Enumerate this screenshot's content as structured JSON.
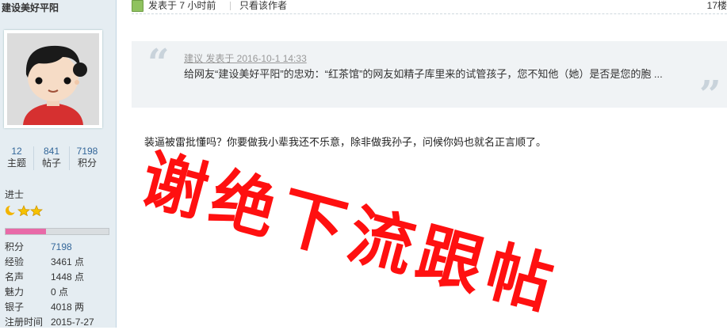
{
  "user": {
    "name": "建设美好平阳",
    "stats": [
      {
        "value": "12",
        "label": "主题"
      },
      {
        "value": "841",
        "label": "帖子"
      },
      {
        "value": "7198",
        "label": "积分"
      }
    ],
    "rank": "进士",
    "star_icons": [
      "moon-icon",
      "star-icon",
      "star-icon"
    ],
    "progress_fraction": 0.39,
    "profile": [
      {
        "key": "积分",
        "value": "7198",
        "link": true
      },
      {
        "key": "经验",
        "value": "3461 点",
        "link": false
      },
      {
        "key": "名声",
        "value": "1448 点",
        "link": false
      },
      {
        "key": "魅力",
        "value": "0 点",
        "link": false
      },
      {
        "key": "银子",
        "value": "4018 两",
        "link": false
      },
      {
        "key": "注册时间",
        "value": "2015-7-27",
        "link": false
      }
    ]
  },
  "post": {
    "posted_label": "发表于 7 小时前",
    "author_only": "只看该作者",
    "floor": "17楼",
    "quote": {
      "header": "建议 发表于 2016-10-1 14:33",
      "text": "给网友“建设美好平阳”的忠劝：“红茶馆”的网友如精子库里来的试管孩子，您不知他（她）是否是您的胞 ..."
    },
    "reply": "装逼被雷批懂吗？你要做我小辈我还不乐意，除非做我孙子，问候你妈也就名正言顺了。",
    "overlay_text": "谢绝下流跟帖"
  },
  "colors": {
    "sidebar_bg": "#e5edf2",
    "link": "#336699",
    "overlay_red": "#ff1010",
    "progress": "#e86aa8"
  }
}
